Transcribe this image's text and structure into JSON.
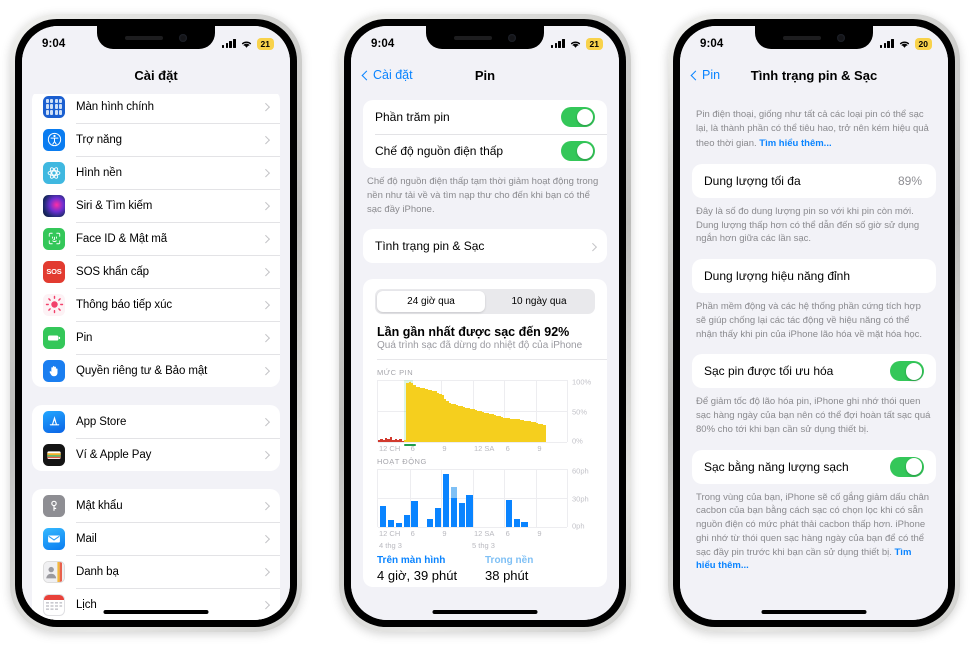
{
  "status": {
    "time": "9:04",
    "battery_p1": "21",
    "battery_p2": "21",
    "battery_p3": "20"
  },
  "phone1": {
    "title": "Cài đặt",
    "groups": [
      {
        "items": [
          {
            "label": "Màn hình chính",
            "icon": "home-screen-icon",
            "color": "#1b5fd0"
          },
          {
            "label": "Trợ năng",
            "icon": "accessibility-icon",
            "color": "#0a7cf0"
          },
          {
            "label": "Hình nền",
            "icon": "wallpaper-icon",
            "color": "#3fb8e0"
          },
          {
            "label": "Siri & Tìm kiếm",
            "icon": "siri-icon",
            "color": "#2b2b3a"
          },
          {
            "label": "Face ID & Mật mã",
            "icon": "faceid-icon",
            "color": "#34c759"
          },
          {
            "label": "SOS khẩn cấp",
            "icon": "sos-icon",
            "color": "#e23b30"
          },
          {
            "label": "Thông báo tiếp xúc",
            "icon": "exposure-notification-icon",
            "color": "#f5f0f3"
          },
          {
            "label": "Pin",
            "icon": "battery-icon",
            "color": "#34c759"
          },
          {
            "label": "Quyền riêng tư & Bảo mật",
            "icon": "privacy-hand-icon",
            "color": "#1a7ef0"
          }
        ]
      },
      {
        "items": [
          {
            "label": "App Store",
            "icon": "app-store-icon",
            "color": "#1a8cf5"
          },
          {
            "label": "Ví & Apple Pay",
            "icon": "wallet-icon",
            "color": "#121212"
          }
        ]
      },
      {
        "items": [
          {
            "label": "Mật khẩu",
            "icon": "passwords-key-icon",
            "color": "#8e8e93"
          },
          {
            "label": "Mail",
            "icon": "mail-icon",
            "color": "#1d9bf5"
          },
          {
            "label": "Danh bạ",
            "icon": "contacts-icon",
            "color": "#b8b8bd"
          },
          {
            "label": "Lịch",
            "icon": "calendar-icon",
            "color": "#ffffff"
          }
        ]
      }
    ]
  },
  "phone2": {
    "back": "Cài đặt",
    "title": "Pin",
    "toggles": [
      {
        "label": "Phần trăm pin",
        "on": true
      },
      {
        "label": "Chế độ nguồn điện thấp",
        "on": true
      }
    ],
    "toggles_footnote": "Chế độ nguồn điện thấp tạm thời giảm hoạt động trong nền như tải về và tìm nạp thư cho đến khi bạn có thể sạc đầy iPhone.",
    "health_row": "Tình trạng pin & Sạc",
    "segments": [
      {
        "label": "24 giờ qua",
        "active": true
      },
      {
        "label": "10 ngày qua",
        "active": false
      }
    ],
    "charge_title": "Lần gần nhất được sạc đến 92%",
    "charge_sub": "Quá trình sạc đã dừng do nhiệt độ của iPhone",
    "legend": [
      {
        "name": "Trên màn hình",
        "value": "4 giờ, 39 phút"
      },
      {
        "name": "Trong nền",
        "value": "38 phút"
      }
    ]
  },
  "phone3": {
    "back": "Pin",
    "title": "Tình trạng pin & Sạc",
    "intro": "Pin điện thoại, giống như tất cả các loại pin có thể sạc lại, là thành phần có thể tiêu hao, trở nên kém hiệu quả theo thời gian. ",
    "intro_link": "Tìm hiểu thêm...",
    "max_capacity_label": "Dung lượng tối đa",
    "max_capacity_value": "89%",
    "max_capacity_note": "Đây là số đo dung lượng pin so với khi pin còn mới. Dung lượng thấp hơn có thể dẫn đến số giờ sử dụng ngắn hơn giữa các lần sạc.",
    "peak_perf_label": "Dung lượng hiệu năng đỉnh",
    "peak_perf_note": "Phần mềm động và các hệ thống phần cứng tích hợp sẽ giúp chống lại các tác động về hiệu năng có thể nhận thấy khi pin của iPhone lão hóa về mặt hóa học.",
    "optimized_label": "Sạc pin được tối ưu hóa",
    "optimized_on": true,
    "optimized_note": "Để giảm tốc độ lão hóa pin, iPhone ghi nhớ thói quen sạc hàng ngày của bạn nên có thể đợi hoàn tất sạc quá 80% cho tới khi bạn cần sử dụng thiết bị.",
    "clean_label": "Sạc bằng năng lượng sạch",
    "clean_on": true,
    "clean_note": "Trong vùng của bạn, iPhone sẽ cố gắng giảm dấu chân cacbon của bạn bằng cách sạc có chọn lọc khi có sẵn nguồn điện có mức phát thải cacbon thấp hơn. iPhone ghi nhớ từ thói quen sạc hàng ngày của bạn để có thể sạc đầy pin trước khi bạn cần sử dụng thiết bị. ",
    "clean_note_link": "Tìm hiểu thêm..."
  },
  "chart_data": [
    {
      "type": "area",
      "title": "MỨC PIN",
      "ylabel": "",
      "ylim": [
        0,
        100
      ],
      "yticks": [
        "0%",
        "50%",
        "100%"
      ],
      "xticks": [
        "12 CH",
        "6",
        "9",
        "12 SA",
        "6",
        "9"
      ],
      "grid": true,
      "series_color": "#f5cf1e",
      "charging_color": "#d13a2e",
      "values": [
        4,
        6,
        3,
        7,
        5,
        8,
        4,
        6,
        3,
        5,
        2,
        4,
        95,
        97,
        96,
        92,
        90,
        89,
        88,
        87,
        86,
        85,
        84,
        83,
        82,
        80,
        78,
        76,
        70,
        66,
        64,
        62,
        61,
        60,
        59,
        58,
        57,
        56,
        55,
        54,
        53,
        52,
        51,
        50,
        49,
        48,
        47,
        46,
        45,
        44,
        43,
        42,
        41,
        40,
        39,
        39,
        38,
        38,
        37,
        37,
        36,
        36,
        35,
        35,
        34,
        33,
        32,
        31,
        30,
        29,
        28,
        0,
        0,
        0,
        0,
        0,
        0,
        0,
        0,
        0
      ],
      "charging_band": {
        "start_index": 11,
        "end_index": 14
      },
      "legend_position": "right"
    },
    {
      "type": "bar",
      "title": "HOẠT ĐỘNG",
      "ylabel": "phút",
      "ylim": [
        0,
        60
      ],
      "yticks": [
        "0ph",
        "30ph",
        "60ph"
      ],
      "xticks": [
        "12 CH",
        "6",
        "9",
        "12 SA",
        "6",
        "9"
      ],
      "date_labels": [
        "4 thg 3",
        "5 thg 3"
      ],
      "grid": true,
      "series": [
        {
          "name": "Trên màn hình",
          "color": "#0a84ff",
          "values": [
            22,
            8,
            4,
            13,
            27,
            0,
            9,
            20,
            55,
            30,
            25,
            33,
            0,
            0,
            0,
            0,
            28,
            9,
            5,
            0,
            0,
            0,
            0,
            0
          ]
        },
        {
          "name": "Trong nền",
          "color": "#7fc0f5",
          "values": [
            0,
            0,
            0,
            0,
            0,
            0,
            0,
            0,
            0,
            12,
            0,
            0,
            0,
            0,
            0,
            0,
            0,
            0,
            0,
            0,
            0,
            0,
            0,
            0
          ]
        }
      ]
    }
  ]
}
